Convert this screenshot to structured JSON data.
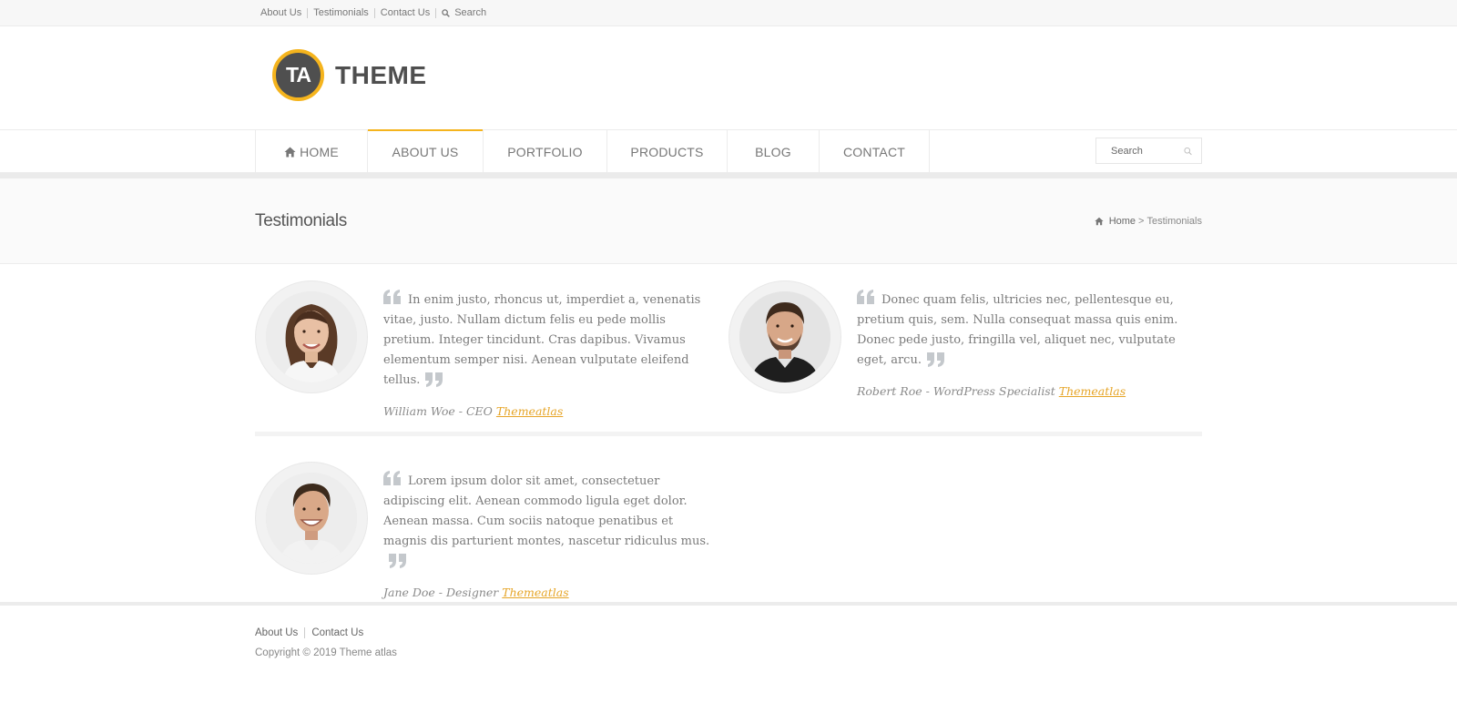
{
  "topbar": {
    "links": [
      "About Us",
      "Testimonials",
      "Contact Us"
    ],
    "search_label": "Search"
  },
  "logo": {
    "initials": "TA",
    "text": "THEME",
    "ring_color": "#f5b41d",
    "circle_color": "#4f4f4f"
  },
  "nav": {
    "items": [
      {
        "label": "HOME",
        "icon": "home-icon"
      },
      {
        "label": "ABOUT US",
        "active": true
      },
      {
        "label": "PORTFOLIO"
      },
      {
        "label": "PRODUCTS"
      },
      {
        "label": "BLOG"
      },
      {
        "label": "CONTACT"
      }
    ],
    "search_placeholder": "Search",
    "accent": "#f5b41d"
  },
  "page": {
    "title": "Testimonials",
    "breadcrumb": {
      "home": "Home",
      "separator": ">",
      "current": "Testimonials"
    }
  },
  "testimonials": [
    {
      "quote": "In enim justo, rhoncus ut, imperdiet a, venenatis vitae, justo. Nullam dictum felis eu pede mollis pretium. Integer tincidunt. Cras dapibus. Vivamus elementum semper nisi. Aenean vulputate eleifend tellus.",
      "author": "William Woe - CEO",
      "company": "Themeatlas",
      "avatar": "woman-portrait"
    },
    {
      "quote": "Donec quam felis, ultricies nec, pellentesque eu, pretium quis, sem. Nulla consequat massa quis enim. Donec pede justo, fringilla vel, aliquet nec, vulputate eget, arcu.",
      "author": "Robert Roe - WordPress Specialist",
      "company": "Themeatlas",
      "avatar": "man-bearded-portrait"
    },
    {
      "quote": "Lorem ipsum dolor sit amet, consectetuer adipiscing elit. Aenean commodo ligula eget dolor. Aenean massa. Cum sociis natoque penatibus et magnis dis parturient montes, nascetur ridiculus mus.",
      "author": "Jane Doe - Designer",
      "company": "Themeatlas",
      "avatar": "man-smiling-portrait"
    }
  ],
  "footer": {
    "links": [
      "About Us",
      "Contact Us"
    ],
    "copyright": "Copyright © 2019 Theme atlas"
  }
}
